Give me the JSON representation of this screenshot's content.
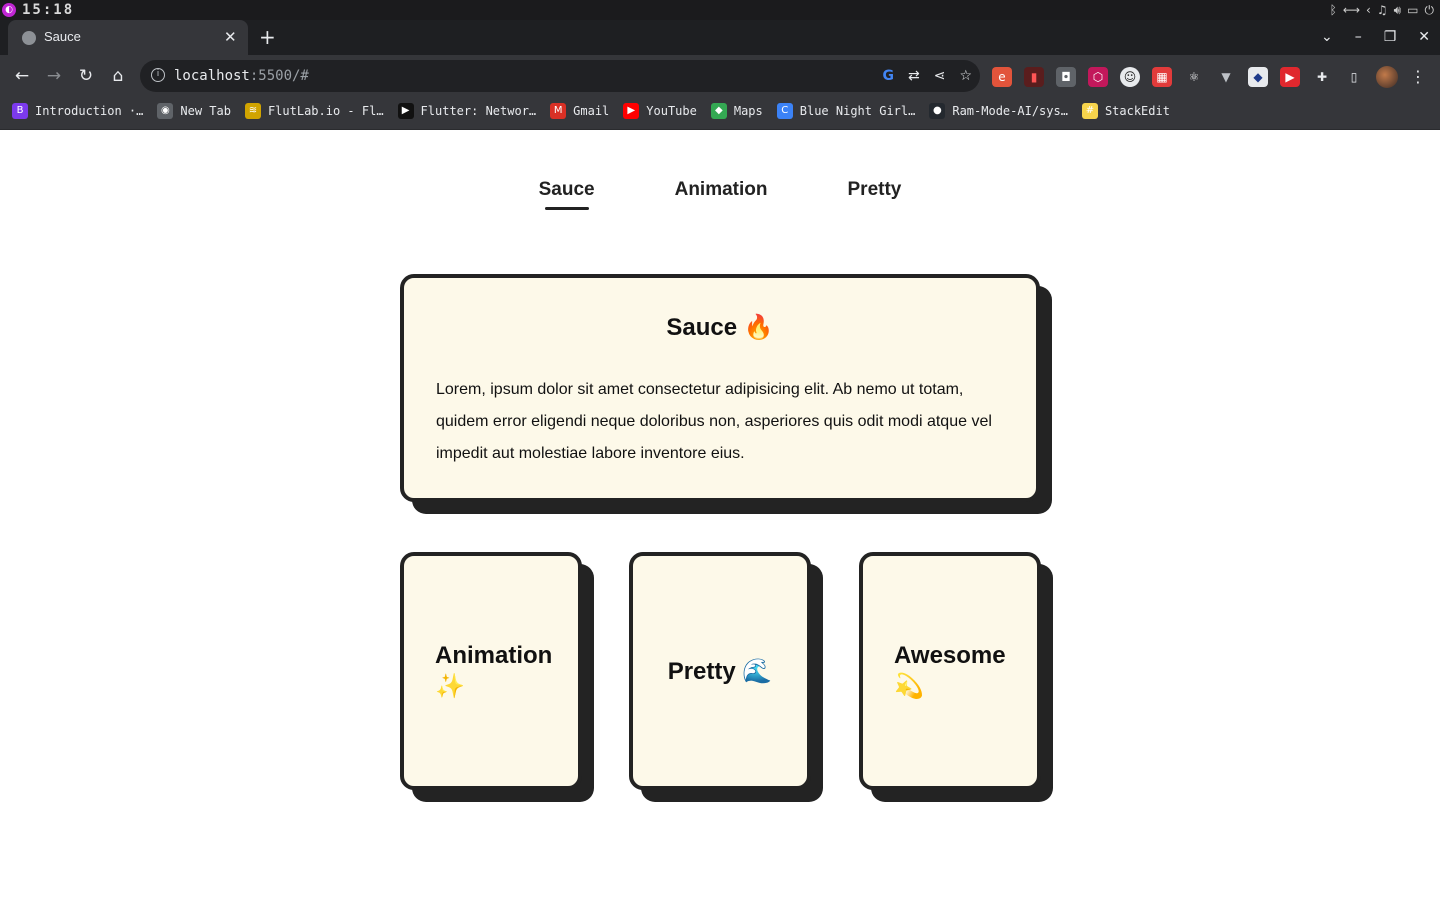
{
  "os": {
    "clock": "15:18",
    "tray_icons": [
      "bluetooth-icon",
      "network-icon",
      "arrow-left-icon",
      "bell-icon",
      "volume-icon",
      "battery-icon",
      "power-icon"
    ]
  },
  "browser": {
    "tab": {
      "title": "Sauce",
      "close": "✕"
    },
    "new_tab": "+",
    "window_controls": [
      "⌄",
      "–",
      "❐",
      "✕"
    ],
    "nav": {
      "back": "←",
      "forward": "→",
      "reload": "↻",
      "home": "⌂"
    },
    "address": {
      "host": "localhost",
      "rest": ":5500/#"
    },
    "bookmarks": [
      {
        "label": "Introduction ·…",
        "icon": "B",
        "color": "#7c3aed"
      },
      {
        "label": "New Tab",
        "icon": "◉",
        "color": "#5f6368"
      },
      {
        "label": "FlutLab.io - Fl…",
        "icon": "≋",
        "color": "#d1a400"
      },
      {
        "label": "Flutter: Networ…",
        "icon": "▶",
        "color": "#111111"
      },
      {
        "label": "Gmail",
        "icon": "M",
        "color": "#d93025"
      },
      {
        "label": "YouTube",
        "icon": "▶",
        "color": "#ff0000"
      },
      {
        "label": "Maps",
        "icon": "◆",
        "color": "#34a853"
      },
      {
        "label": "Blue Night Girl…",
        "icon": "C",
        "color": "#3b82f6"
      },
      {
        "label": "Ram-Mode-AI/sys…",
        "icon": "●",
        "color": "#24292f"
      },
      {
        "label": "StackEdit",
        "icon": "#",
        "color": "#f7d44c"
      }
    ]
  },
  "site": {
    "nav": [
      "Sauce",
      "Animation",
      "Pretty"
    ],
    "hero": {
      "title": "Sauce",
      "emoji": "🔥",
      "text": "Lorem, ipsum dolor sit amet consectetur adipisicing elit. Ab nemo ut totam, quidem error eligendi neque doloribus non, asperiores quis odit modi atque vel impedit aut molestiae labore inventore eius."
    },
    "cards": [
      {
        "title": "Animation",
        "emoji": "✨"
      },
      {
        "title": "Pretty",
        "emoji": "🌊"
      },
      {
        "title": "Awesome",
        "emoji": "💫"
      }
    ]
  },
  "colors": {
    "card_bg": "#fdf9e9",
    "card_border": "#232323",
    "chrome_dark": "#35363a"
  }
}
